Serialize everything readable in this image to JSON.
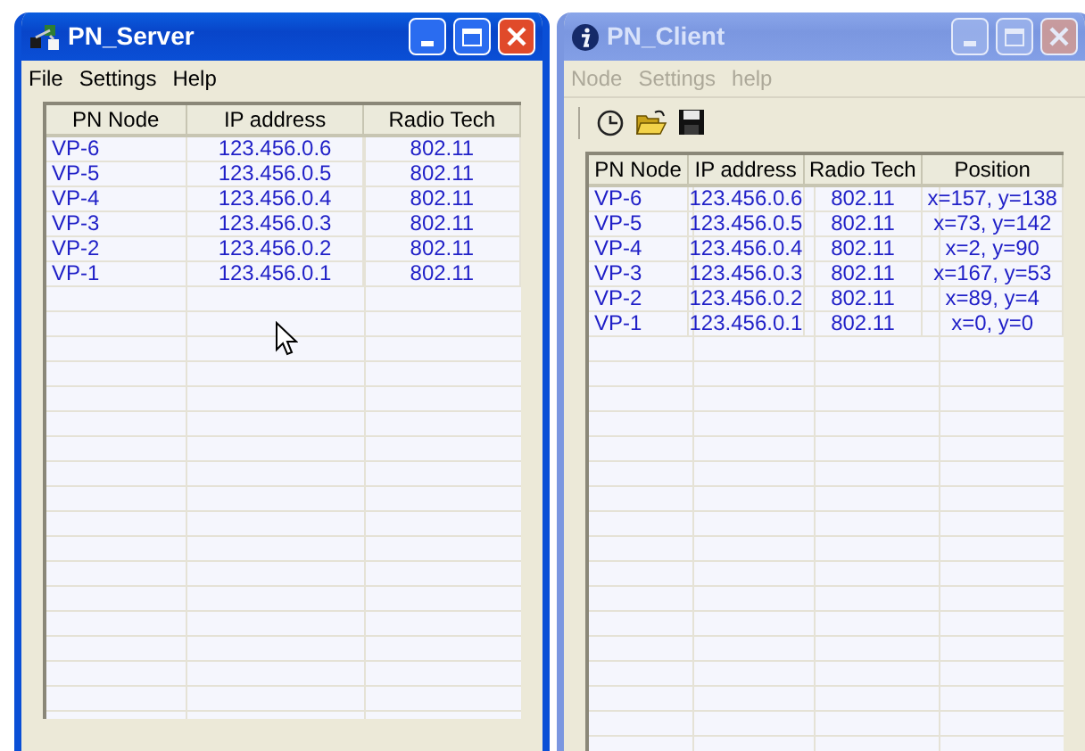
{
  "windows": [
    {
      "title": "PN_Server",
      "active": true,
      "kind": "server",
      "menu": [
        {
          "label": "File",
          "disabled": false
        },
        {
          "label": "Settings",
          "disabled": false
        },
        {
          "label": "Help",
          "disabled": false
        }
      ],
      "table": {
        "columns": [
          "PN Node",
          "IP address",
          "Radio Tech"
        ],
        "rows": [
          [
            "VP-6",
            "123.456.0.6",
            "802.11"
          ],
          [
            "VP-5",
            "123.456.0.5",
            "802.11"
          ],
          [
            "VP-4",
            "123.456.0.4",
            "802.11"
          ],
          [
            "VP-3",
            "123.456.0.3",
            "802.11"
          ],
          [
            "VP-2",
            "123.456.0.2",
            "802.11"
          ],
          [
            "VP-1",
            "123.456.0.1",
            "802.11"
          ]
        ]
      }
    },
    {
      "title": "PN_Client",
      "active": false,
      "kind": "client",
      "menu": [
        {
          "label": "Node",
          "disabled": true
        },
        {
          "label": "Settings",
          "disabled": true
        },
        {
          "label": "help",
          "disabled": true
        }
      ],
      "toolbar": [
        {
          "kind": "clock"
        },
        {
          "kind": "open"
        },
        {
          "kind": "save"
        }
      ],
      "table": {
        "columns": [
          "PN Node",
          "IP address",
          "Radio Tech",
          "Position"
        ],
        "rows": [
          [
            "VP-6",
            "123.456.0.6",
            "802.11",
            "x=157, y=138"
          ],
          [
            "VP-5",
            "123.456.0.5",
            "802.11",
            "x=73, y=142"
          ],
          [
            "VP-4",
            "123.456.0.4",
            "802.11",
            "x=2, y=90"
          ],
          [
            "VP-3",
            "123.456.0.3",
            "802.11",
            "x=167, y=53"
          ],
          [
            "VP-2",
            "123.456.0.2",
            "802.11",
            "x=89, y=4"
          ],
          [
            "VP-1",
            "123.456.0.1",
            "802.11",
            "x=0, y=0"
          ]
        ]
      }
    }
  ]
}
